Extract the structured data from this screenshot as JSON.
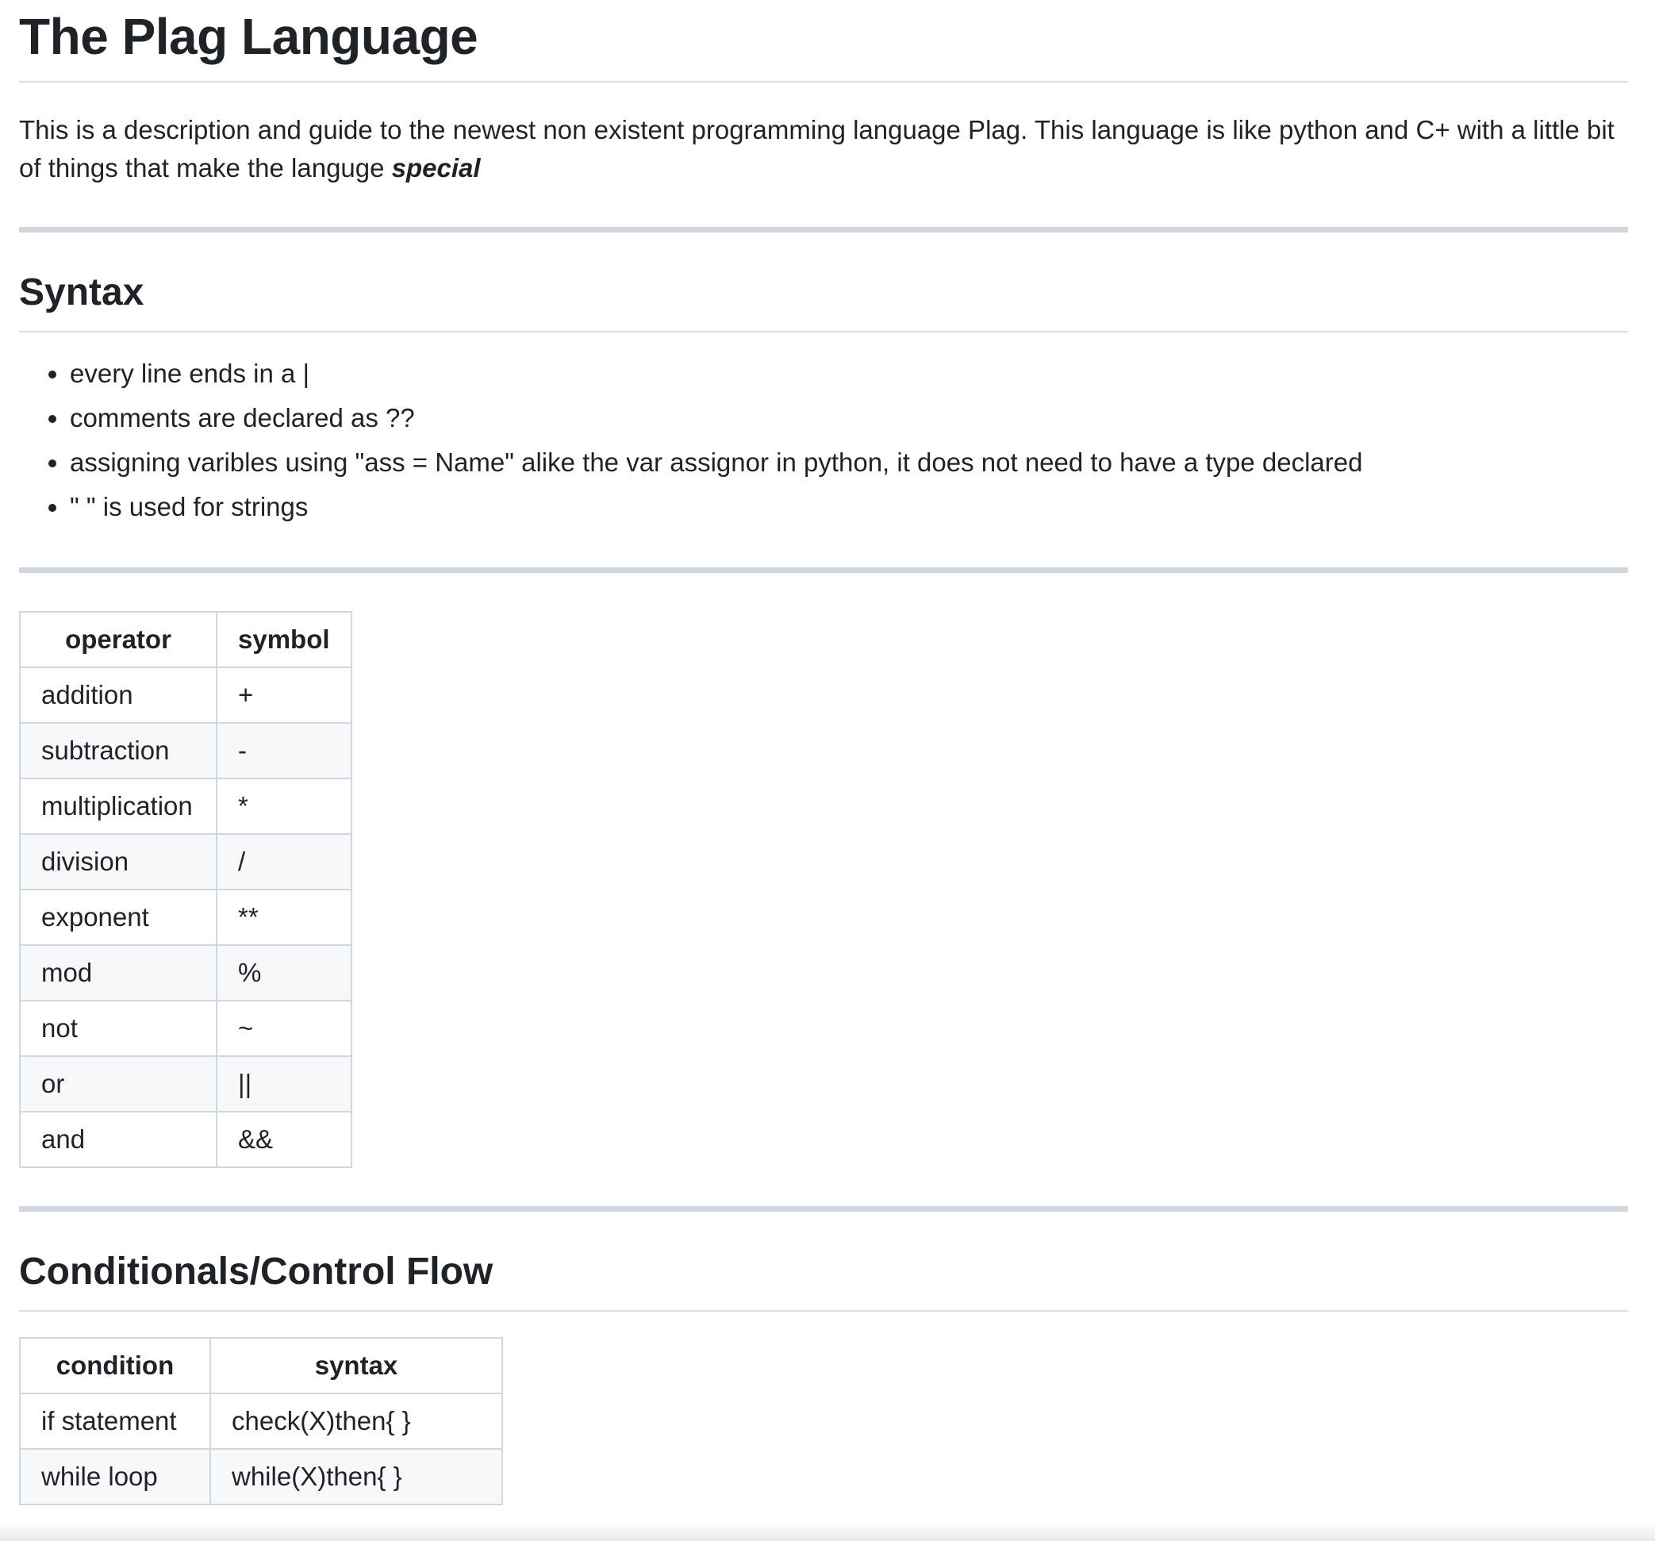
{
  "title": "The Plag Language",
  "intro": {
    "text": "This is a description and guide to the newest non existent programming language Plag. This language is like python and C+ with a little bit of things that make the languge ",
    "emphasis": "special"
  },
  "syntax": {
    "heading": "Syntax",
    "items": [
      "every line ends in a |",
      "comments are declared as ??",
      "assigning varibles using \"ass = Name\" alike the var assignor in python, it does not need to have a type declared",
      "\" \" is used for strings"
    ]
  },
  "operators_table": {
    "headers": [
      "operator",
      "symbol"
    ],
    "rows": [
      [
        "addition",
        "+"
      ],
      [
        "subtraction",
        "-"
      ],
      [
        "multiplication",
        "*"
      ],
      [
        "division",
        "/"
      ],
      [
        "exponent",
        "**"
      ],
      [
        "mod",
        "%"
      ],
      [
        "not",
        "~"
      ],
      [
        "or",
        "||"
      ],
      [
        "and",
        "&&"
      ]
    ]
  },
  "conditionals": {
    "heading": "Conditionals/Control Flow",
    "headers": [
      "condition",
      "syntax"
    ],
    "rows": [
      [
        "if statement",
        "check(X)then{ }"
      ],
      [
        "while loop",
        "while(X)then{ }"
      ]
    ]
  }
}
